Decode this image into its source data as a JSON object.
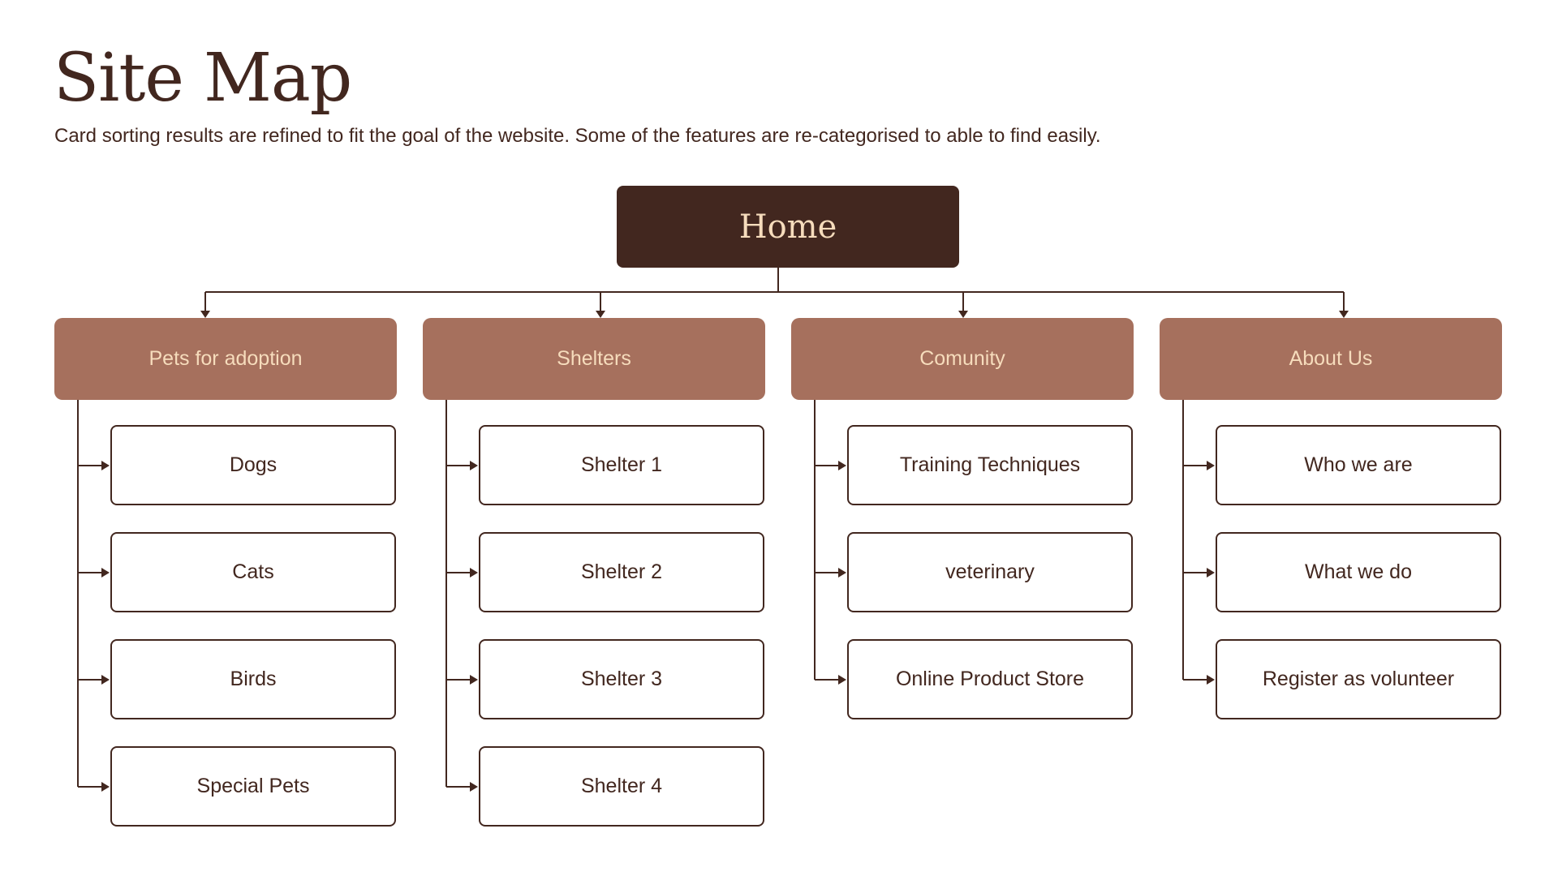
{
  "header": {
    "title": "Site Map",
    "subtitle": "Card sorting results are refined to fit the goal of the website. Some of the features are re-categorised to able to find easily."
  },
  "root": {
    "label": "Home"
  },
  "categories": [
    {
      "label": "Pets for adoption",
      "children": [
        "Dogs",
        "Cats",
        "Birds",
        "Special Pets"
      ]
    },
    {
      "label": "Shelters",
      "children": [
        "Shelter 1",
        "Shelter 2",
        "Shelter 3",
        "Shelter 4"
      ]
    },
    {
      "label": "Comunity",
      "children": [
        "Training Techniques",
        "veterinary",
        "Online Product Store"
      ]
    },
    {
      "label": "About Us",
      "children": [
        "Who we are",
        "What we do",
        "Register as volunteer"
      ]
    }
  ],
  "colors": {
    "primary_dark": "#42271f",
    "category_fill": "#a6705d",
    "category_text": "#f6dcbc",
    "background": "#ffffff"
  }
}
